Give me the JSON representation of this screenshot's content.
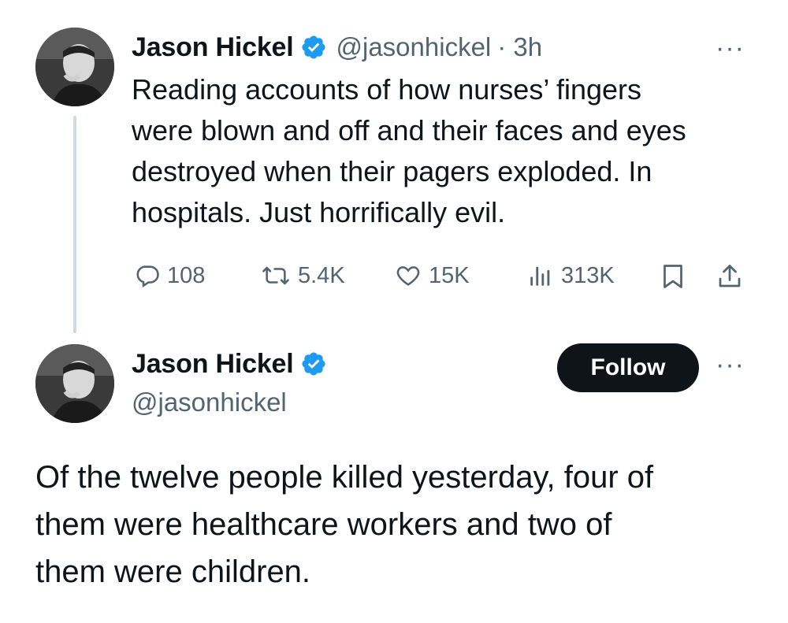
{
  "reply_tweet": {
    "author_name": "Jason Hickel",
    "handle": "@jasonhickel",
    "time": "· 3h",
    "more": "···",
    "text_lines": [
      "Reading accounts of how nurses’ fingers",
      "were blown and off and their faces and eyes",
      "destroyed when their pagers exploded. In",
      "hospitals.  Just horrifically evil."
    ],
    "stats": {
      "replies": "108",
      "reposts": "5.4K",
      "likes": "15K",
      "views": "313K"
    }
  },
  "main_tweet": {
    "author_name": "Jason Hickel",
    "handle": "@jasonhickel",
    "follow_label": "Follow",
    "more": "···",
    "text_lines": [
      "Of the twelve people killed yesterday, four of",
      "them were healthcare workers and two of",
      "them were children."
    ]
  },
  "icons": {
    "verified": "verified-badge-icon",
    "reply": "reply-bubble-icon",
    "repost": "repost-icon",
    "like": "heart-icon",
    "views": "views-bars-icon",
    "bookmark": "bookmark-icon",
    "share": "share-icon"
  },
  "colors": {
    "verified_blue": "#1d9bf0",
    "text_primary": "#0f1419",
    "text_secondary": "#536471",
    "thread_line": "#cfd9de"
  }
}
